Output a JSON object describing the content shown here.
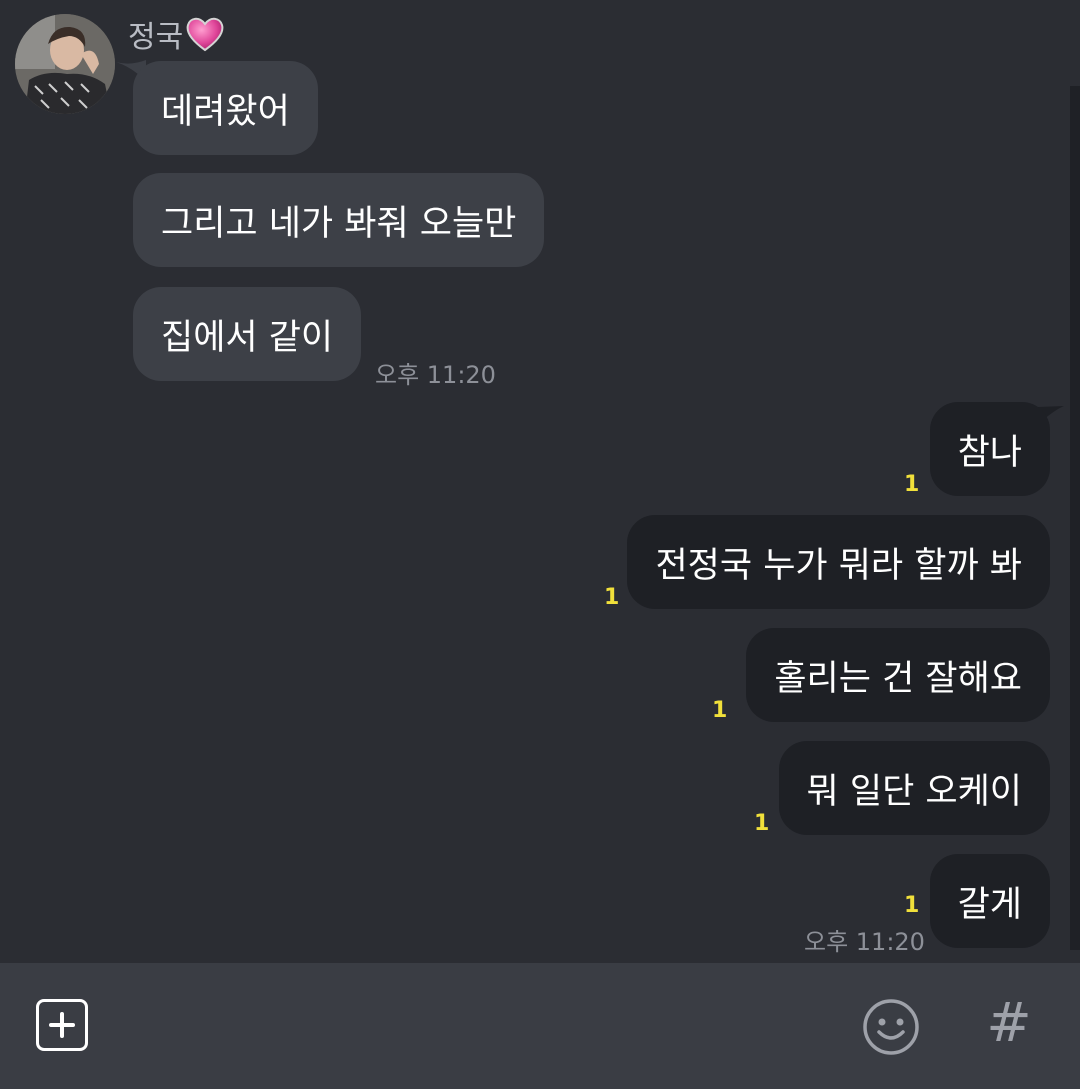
{
  "sender": {
    "name": "정국",
    "name_emoji": "heart-icon"
  },
  "incoming": [
    {
      "text": "데려왔어"
    },
    {
      "text": "그리고 네가 봐줘 오늘만"
    },
    {
      "text": "집에서 같이"
    }
  ],
  "incoming_time": "오후 11:20",
  "outgoing": [
    {
      "text": "참나",
      "unread": "1"
    },
    {
      "text": "전정국 누가 뭐라 할까 봐",
      "unread": "1"
    },
    {
      "text": "홀리는 건 잘해요",
      "unread": "1"
    },
    {
      "text": "뭐 일단 오케이",
      "unread": "1"
    },
    {
      "text": "갈게",
      "unread": "1"
    }
  ],
  "outgoing_time": "오후 11:20",
  "input_bar": {
    "add_icon": "plus-icon",
    "emoji_icon": "smiley-icon",
    "hash_icon": "#"
  },
  "colors": {
    "background": "#2b2d33",
    "incoming_bubble": "#3d4047",
    "outgoing_bubble": "#1e2025",
    "unread": "#f1e03b",
    "input_bar": "#3a3d44"
  }
}
